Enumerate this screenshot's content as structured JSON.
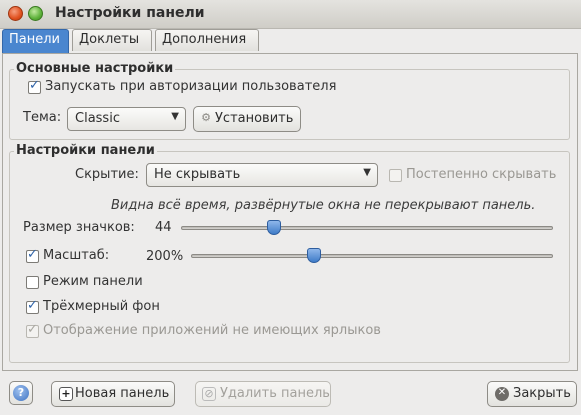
{
  "window": {
    "title": "Настройки панели"
  },
  "tabs": [
    {
      "label": "Панели",
      "active": true
    },
    {
      "label": "Доклеты",
      "active": false
    },
    {
      "label": "Дополнения",
      "active": false
    }
  ],
  "basic": {
    "title": "Основные настройки",
    "autostart": {
      "label": "Запускать при авторизации пользователя",
      "checked": true
    },
    "theme_label": "Тема:",
    "theme_value": "Classic",
    "install_label": "Установить"
  },
  "panel": {
    "title": "Настройки панели",
    "hiding_label": "Скрытие:",
    "hiding_value": "Не скрывать",
    "gradual_label": "Постепенно скрывать",
    "gradual_checked": false,
    "hint": "Видна всё время, развёрнутые окна не перекрывают панель.",
    "icon_size_label": "Размер значков:",
    "icon_size_value": "44",
    "icon_size_fraction": 0.25,
    "scale_label": "Масштаб:",
    "scale_checked": true,
    "scale_value": "200%",
    "scale_fraction": 0.34,
    "panel_mode_label": "Режим панели",
    "panel_mode_checked": false,
    "bg3d_label": "Трёхмерный фон",
    "bg3d_checked": true,
    "no_icons_label": "Отображение приложений не имеющих ярлыков",
    "no_icons_checked": true
  },
  "footer": {
    "new_panel_label": "Новая панель",
    "delete_panel_label": "Удалить панель",
    "close_label": "Закрыть"
  },
  "colors": {
    "accent": "#4a86cf",
    "thumb": "#3f7cc8"
  }
}
